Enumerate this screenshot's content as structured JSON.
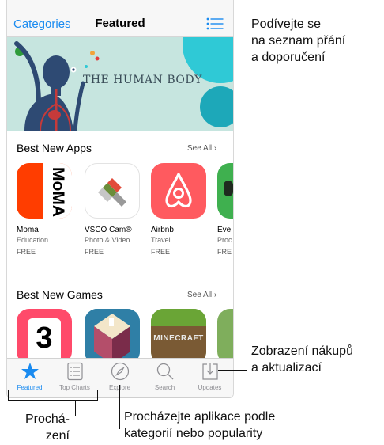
{
  "navbar": {
    "left_label": "Categories",
    "title": "Featured",
    "list_icon": "list-icon"
  },
  "banner": {
    "title": "THE HUMAN BODY"
  },
  "sections": {
    "apps": {
      "title": "Best New Apps",
      "see_all": "See All"
    },
    "games": {
      "title": "Best New Games",
      "see_all": "See All"
    }
  },
  "apps": [
    {
      "name": "Moma",
      "category": "Education",
      "price": "FREE",
      "icon_text": "MoMA"
    },
    {
      "name": "VSCO Cam®",
      "category": "Photo & Video",
      "price": "FREE"
    },
    {
      "name": "Airbnb",
      "category": "Travel",
      "price": "FREE"
    },
    {
      "name": "Eve",
      "category": "Proc",
      "price": "FRE"
    }
  ],
  "games": [
    {
      "icon_text": "3"
    },
    {},
    {
      "icon_text": "MINECRAFT"
    },
    {}
  ],
  "tabs": [
    {
      "label": "Featured",
      "icon": "star-icon",
      "active": true
    },
    {
      "label": "Top Charts",
      "icon": "list-icon"
    },
    {
      "label": "Explore",
      "icon": "compass-icon"
    },
    {
      "label": "Search",
      "icon": "search-icon"
    },
    {
      "label": "Updates",
      "icon": "download-icon"
    }
  ],
  "callouts": {
    "wishlist": [
      "Podívejte se",
      "na seznam přání",
      "a doporučení"
    ],
    "purchases": [
      "Zobrazení nákupů",
      "a aktualizací"
    ],
    "browse": [
      "Prochá-",
      "zení"
    ],
    "explore": [
      "Procházejte aplikace podle",
      "kategorií nebo popularity"
    ]
  },
  "colors": {
    "accent": "#1a8bf0",
    "moma": "#ff3d00",
    "airbnb": "#ff5a5f",
    "banner": "#c6e5df"
  }
}
